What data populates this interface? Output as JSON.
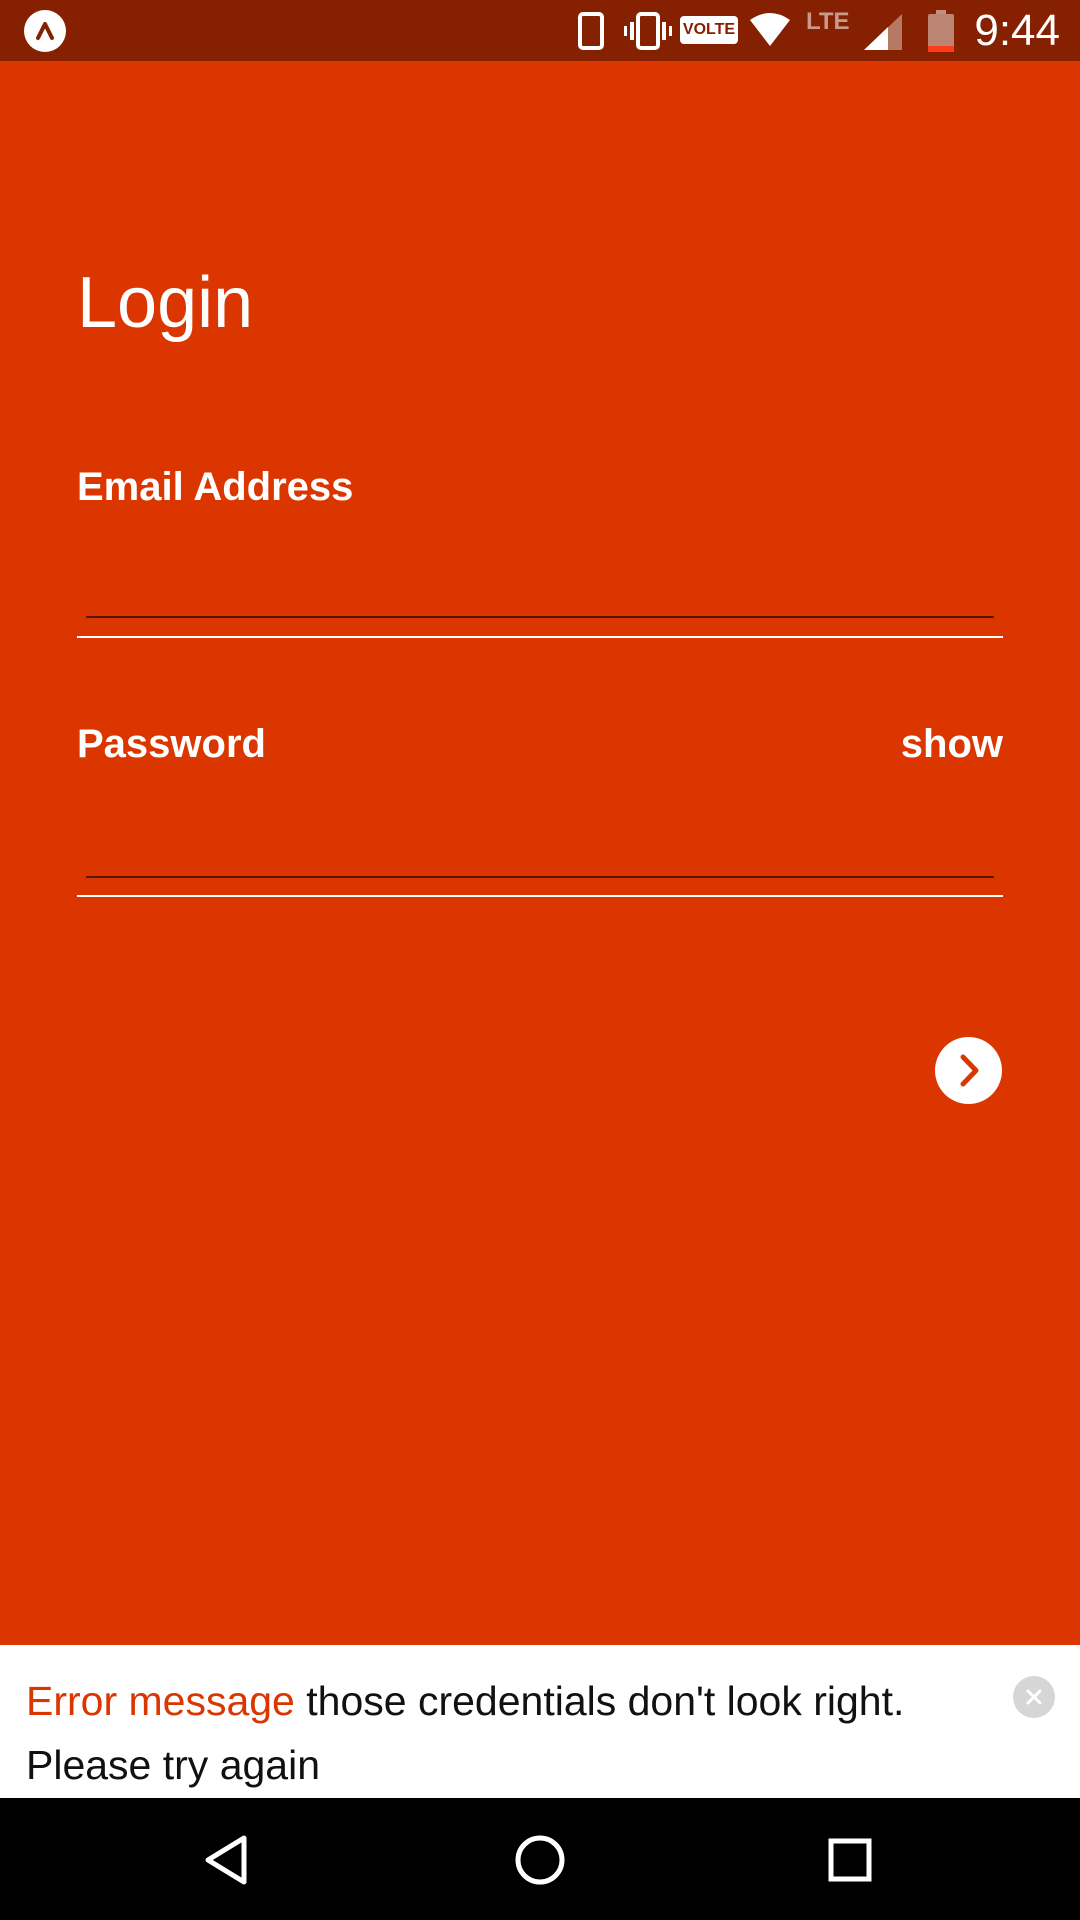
{
  "status_bar": {
    "time": "9:44",
    "volte": "VOLTE",
    "network": "LTE",
    "icons": [
      "app-icon",
      "phone-icon",
      "vibrate-icon",
      "volte-icon",
      "wifi-icon",
      "signal-icon",
      "battery-icon"
    ]
  },
  "login": {
    "title": "Login",
    "email_label": "Email Address",
    "email_value": "",
    "password_label": "Password",
    "password_value": "",
    "show_label": "show",
    "submit_icon": "chevron-right-icon"
  },
  "toast": {
    "label": "Error message",
    "message": " those credentials don't look right. Please try again",
    "close_icon": "close-icon"
  },
  "nav": {
    "icons": [
      "back-icon",
      "home-icon",
      "recents-icon"
    ]
  },
  "colors": {
    "background": "#DB3600",
    "status_bar": "#852100",
    "toast_label": "#DB3600",
    "toast_bg": "#FFFFFF"
  }
}
